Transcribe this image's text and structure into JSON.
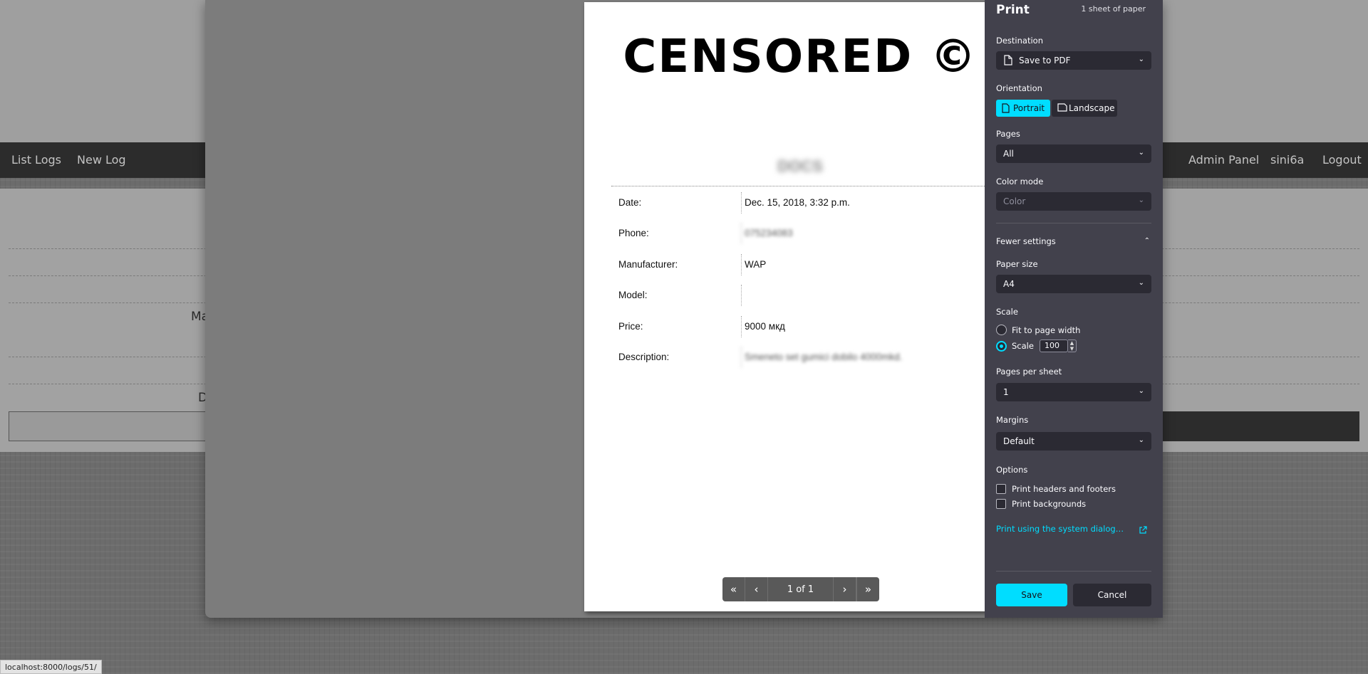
{
  "background_page": {
    "nav": {
      "left_items": [
        "List Logs",
        "New Log"
      ],
      "right_items": [
        "Admin Panel",
        "sini6a",
        "Logout"
      ]
    },
    "fragments": [
      "Ma",
      "D"
    ]
  },
  "preview": {
    "heading": "CENSORED ©",
    "subtitle": "DOCS",
    "records": [
      {
        "label": "Date:",
        "value": "Dec. 15, 2018, 3:32 p.m.",
        "blurred": false
      },
      {
        "label": "Phone:",
        "value": "075234083",
        "blurred": true
      },
      {
        "label": "Manufacturer:",
        "value": "WAP",
        "blurred": false
      },
      {
        "label": "Model:",
        "value": "",
        "blurred": false
      },
      {
        "label": "Price:",
        "value": "9000 мкд",
        "blurred": false
      },
      {
        "label": "Description:",
        "value": "Smeneto set gumici dobilo 4000mkd.",
        "blurred": true
      }
    ],
    "pager": {
      "first": "«",
      "prev": "‹",
      "page_text": "1 of 1",
      "next": "›",
      "last": "»"
    }
  },
  "print_panel": {
    "title": "Print",
    "sheet_count": "1 sheet of paper",
    "destination": {
      "label": "Destination",
      "value": "Save to PDF"
    },
    "orientation": {
      "label": "Orientation",
      "portrait": "Portrait",
      "landscape": "Landscape",
      "selected": "Portrait"
    },
    "pages": {
      "label": "Pages",
      "value": "All"
    },
    "color_mode": {
      "label": "Color mode",
      "value": "Color"
    },
    "fewer_settings": "Fewer settings",
    "paper_size": {
      "label": "Paper size",
      "value": "A4"
    },
    "scale": {
      "label": "Scale",
      "fit_option": "Fit to page width",
      "scale_option": "Scale",
      "value": "100"
    },
    "pages_per_sheet": {
      "label": "Pages per sheet",
      "value": "1"
    },
    "margins": {
      "label": "Margins",
      "value": "Default"
    },
    "options": {
      "label": "Options",
      "headers_footers": "Print headers and footers",
      "backgrounds": "Print backgrounds"
    },
    "system_dialog_link": "Print using the system dialog…",
    "save_label": "Save",
    "cancel_label": "Cancel"
  },
  "status_bar": {
    "url": "localhost:8000/logs/51/"
  },
  "colors": {
    "accent": "#00ddff",
    "panel_bg": "#42414c",
    "control_bg": "#2b2a33"
  }
}
